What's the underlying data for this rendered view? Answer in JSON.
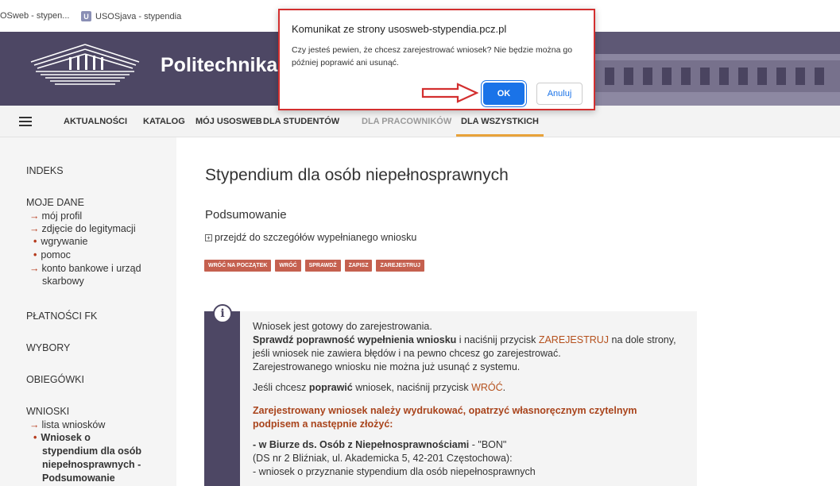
{
  "tabs": [
    {
      "label": "OSweb - stypen...",
      "favicon": ""
    },
    {
      "label": "USOSjava - stypendia",
      "favicon": "U"
    }
  ],
  "header": {
    "brand": "Politechnika C"
  },
  "nav": {
    "items": [
      {
        "label": "AKTUALNOŚCI",
        "state": "normal"
      },
      {
        "label": "KATALOG",
        "state": "normal"
      },
      {
        "label": "MÓJ USOSWEB",
        "state": "normal"
      },
      {
        "label": "DLA STUDENTÓW",
        "state": "normal"
      },
      {
        "label": "DLA PRACOWNIKÓW",
        "state": "dim"
      },
      {
        "label": "DLA WSZYSTKICH",
        "state": "active"
      }
    ]
  },
  "sidebar": {
    "indeks": "INDEKS",
    "moje_dane": "MOJE DANE",
    "moj_profil": "mój profil",
    "zdjecie": "zdjęcie do legitymacji",
    "wgrywanie": "wgrywanie",
    "pomoc": "pomoc",
    "konto_line1": "konto bankowe i urząd",
    "konto_line2": "skarbowy",
    "platnosci": "PŁATNOŚCI FK",
    "wybory": "WYBORY",
    "obiegowki": "OBIEGÓWKI",
    "wnioski": "WNIOSKI",
    "lista": "lista wniosków",
    "current_1": "Wniosek o",
    "current_2": "stypendium dla osób",
    "current_3": "niepełnosprawnych -",
    "current_4": "Podsumowanie"
  },
  "main": {
    "title": "Stypendium dla osób niepełnosprawnych",
    "section": "Podsumowanie",
    "details_link": "przejdź do szczegółów wypełnianego wniosku",
    "buttons": [
      "WRÓĆ NA POCZĄTEK",
      "WRÓĆ",
      "SPRAWDŹ",
      "ZAPISZ",
      "ZAREJESTRUJ"
    ]
  },
  "info": {
    "icon": "i",
    "l1": "Wniosek jest gotowy do zarejestrowania.",
    "l2a": "Sprawdź poprawność wypełnienia wniosku",
    "l2b": " i naciśnij przycisk ",
    "l2c": "ZAREJESTRUJ",
    "l2d": " na dole strony,",
    "l3": "jeśli wniosek nie zawiera błędów i na pewno chcesz go zarejestrować.",
    "l4": "Zarejestrowanego wniosku nie można już usunąć z systemu.",
    "l5a": "Jeśli chcesz ",
    "l5b": "poprawić",
    "l5c": " wniosek, naciśnij przycisk ",
    "l5d": "WRÓĆ",
    "l5e": ".",
    "l6": "Zarejestrowany wniosek należy wydrukować, opatrzyć własnoręcznym czytelnym",
    "l7": "podpisem a następnie złożyć:",
    "l8a": "- w Biurze ds. Osób z Niepełnosprawnościami",
    "l8b": " - \"BON\"",
    "l9": "(DS nr 2 Bliźniak, ul. Akademicka 5, 42-201 Częstochowa):",
    "l10": "- wniosek o przyznanie stypendium dla osób niepełnosprawnych"
  },
  "dialog": {
    "title": "Komunikat ze strony usosweb-stypendia.pcz.pl",
    "message": "Czy jesteś pewien, że chcesz zarejestrować wniosek? Nie będzie można go później poprawić ani usunąć.",
    "ok": "OK",
    "cancel": "Anuluj"
  },
  "colors": {
    "accent": "#4d4764",
    "highlight": "#b5501c",
    "button": "#c5604f",
    "nav_active": "#e8a23a",
    "dialog_border": "#d32f2f",
    "ok_blue": "#1a73e8"
  }
}
